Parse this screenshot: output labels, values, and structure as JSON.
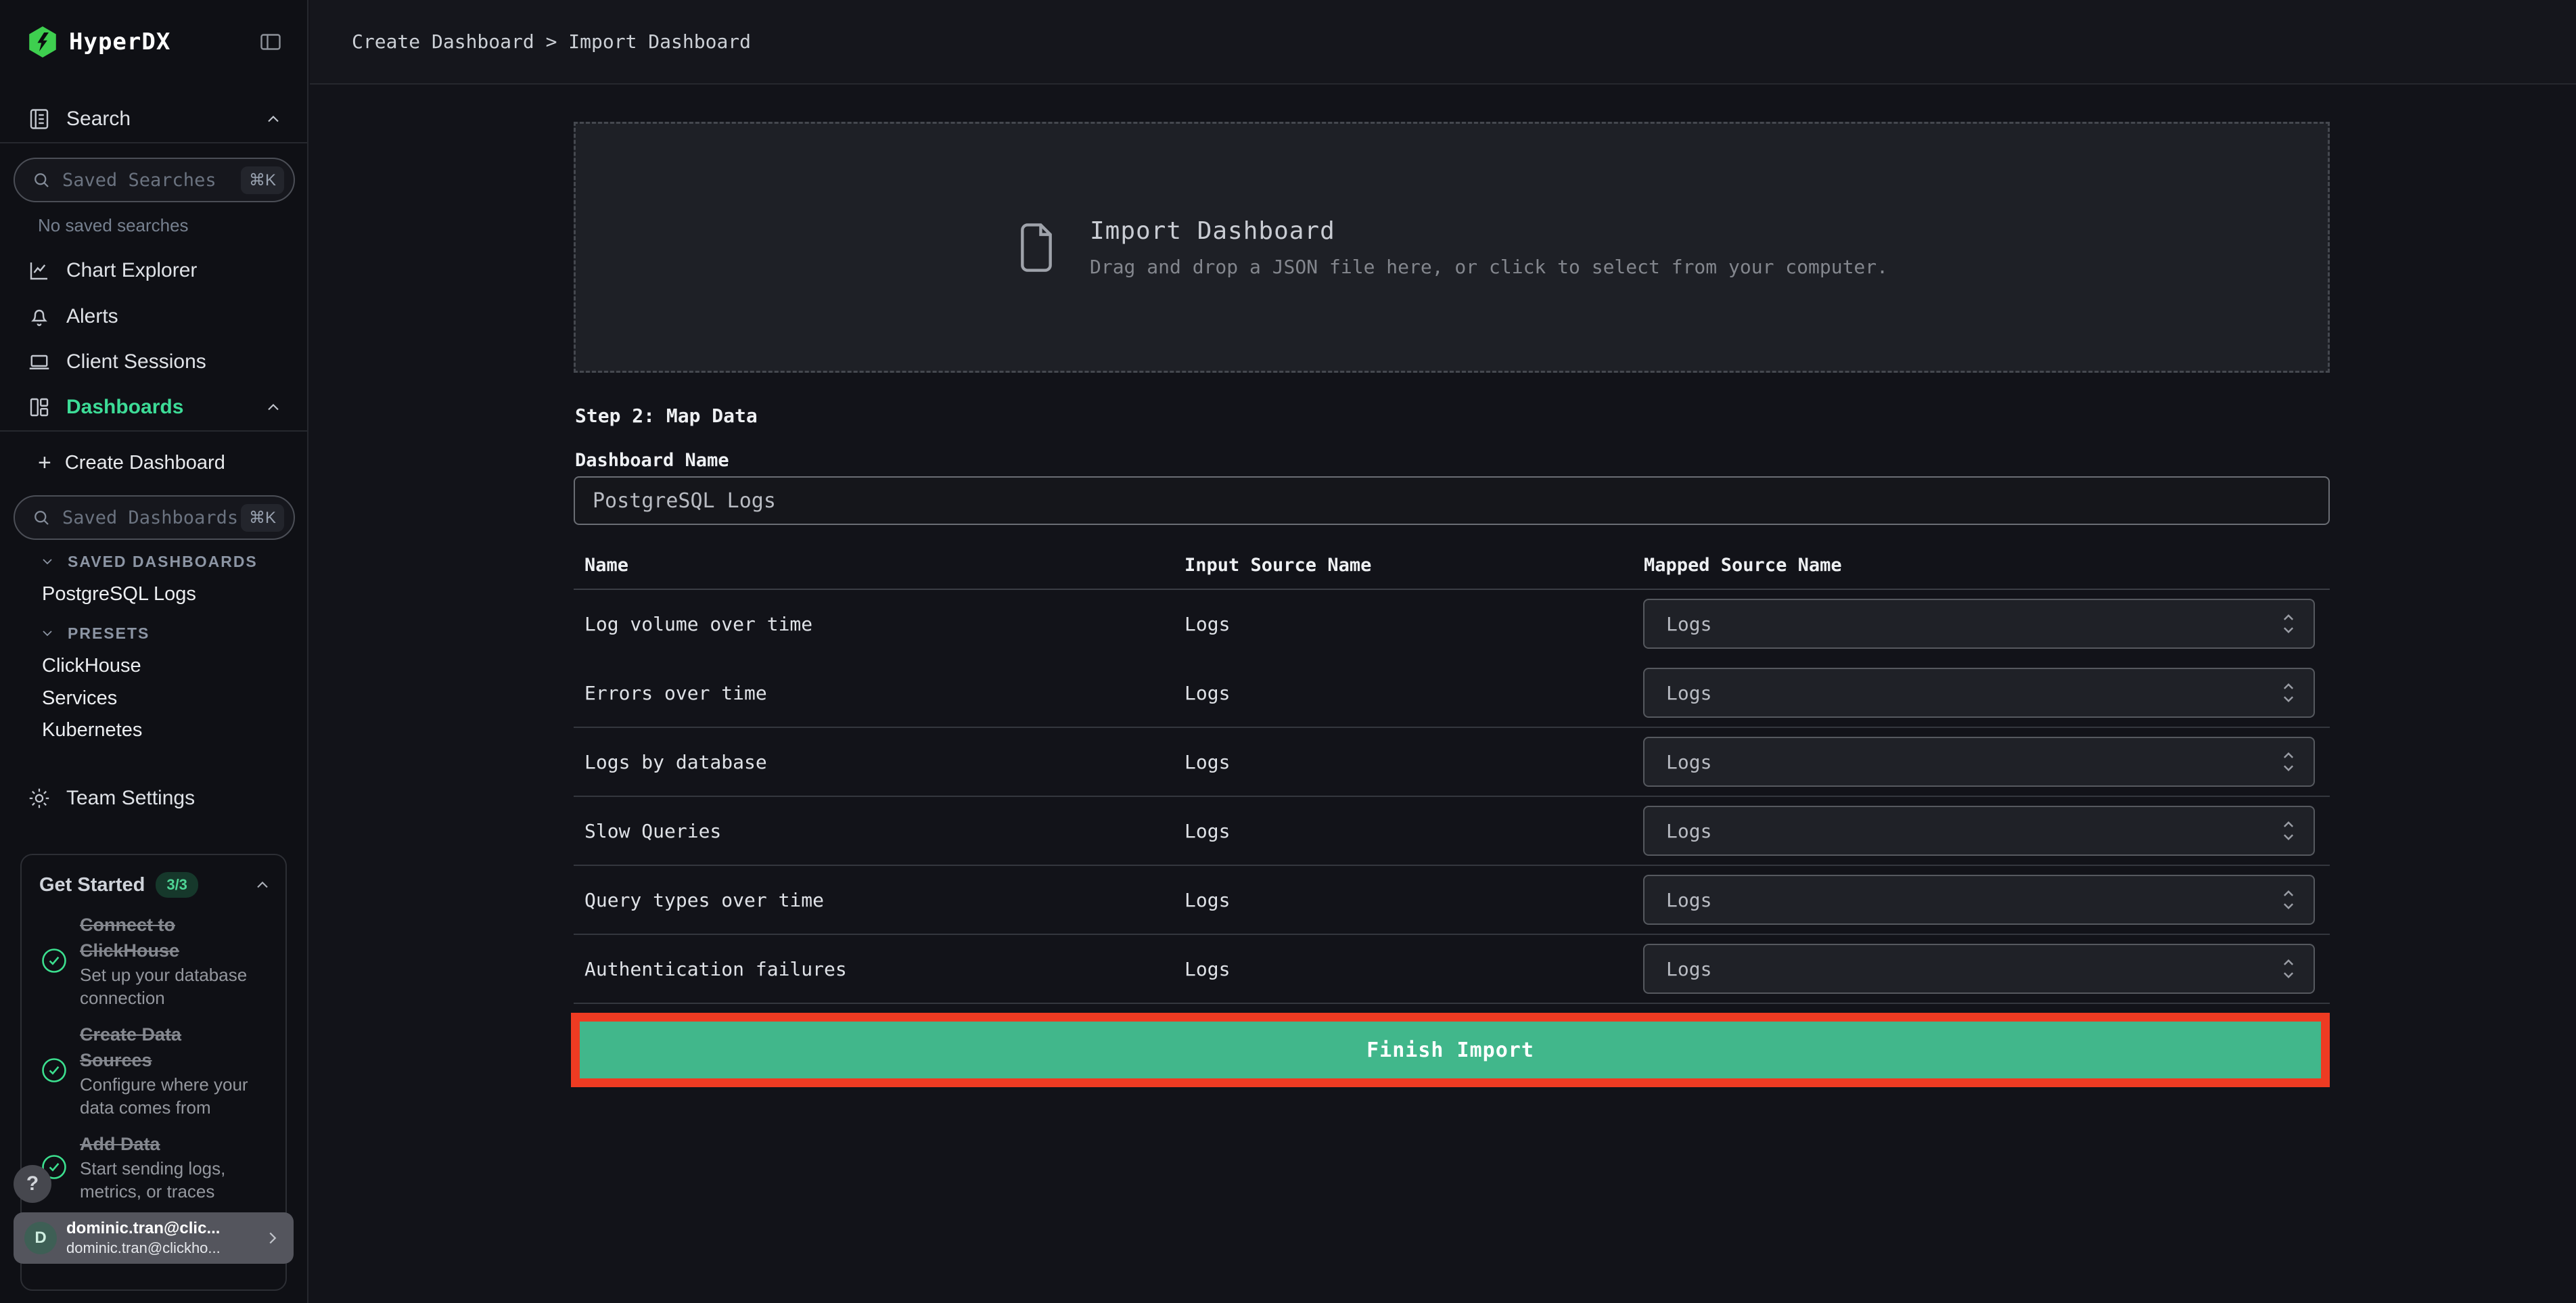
{
  "app": {
    "name": "HyperDX"
  },
  "topbar": {
    "breadcrumb": "Create Dashboard > Import Dashboard"
  },
  "sidebar": {
    "search_section_label": "Search",
    "saved_searches_placeholder": "Saved Searches",
    "shortcut": "⌘K",
    "no_saved_searches": "No saved searches",
    "nav": [
      {
        "label": "Chart Explorer"
      },
      {
        "label": "Alerts"
      },
      {
        "label": "Client Sessions"
      },
      {
        "label": "Dashboards"
      }
    ],
    "create_dashboard_label": "Create Dashboard",
    "create_dashboard_plus": "+",
    "saved_dashboards_placeholder": "Saved Dashboards",
    "saved_dashboards_header": "SAVED DASHBOARDS",
    "saved_dashboard_item": "PostgreSQL Logs",
    "presets_header": "PRESETS",
    "presets": [
      {
        "label": "ClickHouse"
      },
      {
        "label": "Services"
      },
      {
        "label": "Kubernetes"
      }
    ],
    "team_settings_label": "Team Settings",
    "get_started": {
      "title": "Get Started",
      "badge": "3/3",
      "items": [
        {
          "title": "Connect to ClickHouse",
          "desc": "Set up your database connection"
        },
        {
          "title": "Create Data Sources",
          "desc": "Configure where your data comes from"
        },
        {
          "title": "Add Data",
          "desc": "Start sending logs, metrics, or traces"
        }
      ]
    },
    "help_label": "?",
    "user": {
      "initial": "D",
      "line1": "dominic.tran@clic...",
      "line2": "dominic.tran@clickho..."
    }
  },
  "main": {
    "dropzone": {
      "title": "Import Dashboard",
      "subtitle": "Drag and drop a JSON file here, or click to select from your computer."
    },
    "step_title": "Step 2: Map Data",
    "dashboard_name_label": "Dashboard Name",
    "dashboard_name_value": "PostgreSQL Logs",
    "table": {
      "columns": [
        "Name",
        "Input Source Name",
        "Mapped Source Name"
      ],
      "rows": [
        {
          "name": "Log volume over time",
          "input_source": "Logs",
          "mapped_source": "Logs"
        },
        {
          "name": "Errors over time",
          "input_source": "Logs",
          "mapped_source": "Logs"
        },
        {
          "name": "Logs by database",
          "input_source": "Logs",
          "mapped_source": "Logs"
        },
        {
          "name": "Slow Queries",
          "input_source": "Logs",
          "mapped_source": "Logs"
        },
        {
          "name": "Query types over time",
          "input_source": "Logs",
          "mapped_source": "Logs"
        },
        {
          "name": "Authentication failures",
          "input_source": "Logs",
          "mapped_source": "Logs"
        }
      ]
    },
    "finish_button_label": "Finish Import"
  },
  "colors": {
    "accent_green": "#3ddc97",
    "button_green": "#41b78b",
    "annotation_red": "#ee3b22",
    "badge_green": "#4fd596",
    "logo_green": "#3ecf4f"
  }
}
